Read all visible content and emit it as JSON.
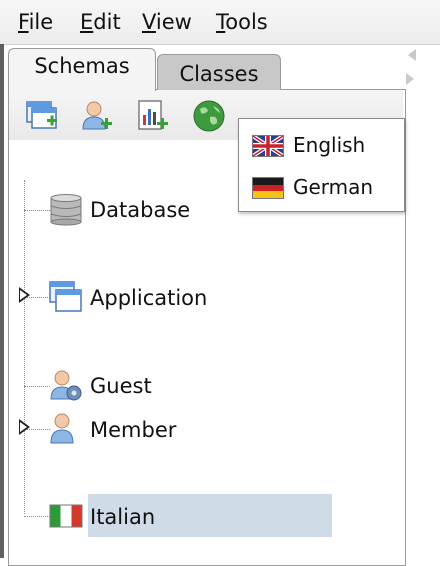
{
  "menubar": {
    "items": [
      {
        "mnemonic": "F",
        "rest": "ile"
      },
      {
        "mnemonic": "E",
        "rest": "dit"
      },
      {
        "mnemonic": "V",
        "rest": "iew"
      },
      {
        "mnemonic": "T",
        "rest": "ools"
      }
    ]
  },
  "tabs": [
    {
      "label": "Schemas",
      "active": true
    },
    {
      "label": "Classes",
      "active": false
    }
  ],
  "toolbar": {
    "icons": [
      "new-window-icon",
      "add-user-icon",
      "add-chart-icon",
      "globe-icon"
    ]
  },
  "tree": {
    "items": [
      {
        "label": "Database",
        "icon": "database-icon",
        "expandable": false,
        "selected": false
      },
      {
        "label": "Application",
        "icon": "application-window-icon",
        "expandable": true,
        "selected": false
      },
      {
        "label": "Guest",
        "icon": "guest-user-icon",
        "expandable": false,
        "selected": false
      },
      {
        "label": "Member",
        "icon": "member-user-icon",
        "expandable": true,
        "selected": false
      },
      {
        "label": "Italian",
        "icon": "italian-flag-icon",
        "expandable": false,
        "selected": true
      }
    ]
  },
  "language_menu": {
    "items": [
      {
        "label": "English",
        "icon": "uk-flag-icon"
      },
      {
        "label": "German",
        "icon": "german-flag-icon"
      }
    ]
  },
  "colors": {
    "selection": "#cfdbe6",
    "tab_inactive": "#c8c8c8",
    "tab_active": "#f4f4f4"
  }
}
